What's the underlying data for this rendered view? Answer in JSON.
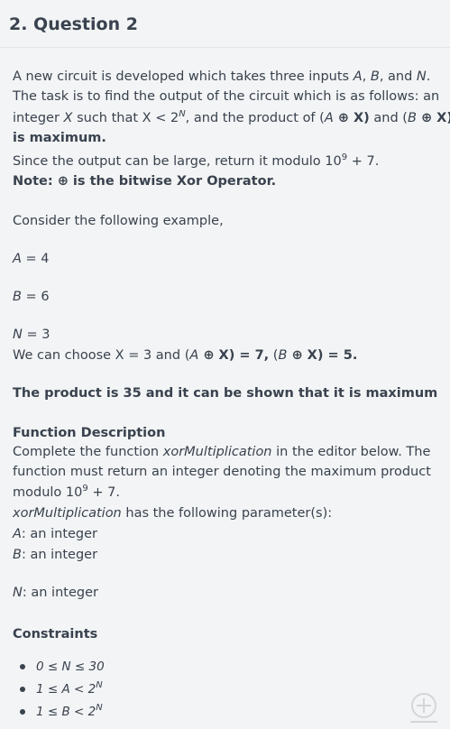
{
  "header": {
    "title": "2. Question 2"
  },
  "intro": {
    "l1_a": "A new circuit is developed which takes three inputs ",
    "l1_A": "A",
    "l1_comma": ", ",
    "l1_B": "B",
    "l1_and": ", and ",
    "l1_N": "N",
    "l1_end": ".",
    "l2": "The task is to find the output of the circuit which is as follows: an",
    "l3_a": "integer ",
    "l3_X": "X",
    "l3_b": " such that X < 2",
    "l3_N": "N",
    "l3_c": ", and the product of (",
    "l3_A": "A",
    "l3_xor1": " ⊕ ",
    "l3_d": "X)",
    "l3_e": " and (",
    "l3_B": "B",
    "l3_xor2": " ⊕ ",
    "l3_f": "X)",
    "l4": "is maximum.",
    "l5_a": "Since the output can be large, return it modulo 10",
    "l5_exp": "9",
    "l5_b": " + 7.",
    "l6_a": "Note: ",
    "l6_sym": "⊕",
    "l6_b": " is the bitwise Xor Operator."
  },
  "example": {
    "intro": "Consider the following example,",
    "a_var": "A",
    "a_val": " = 4",
    "b_var": "B",
    "b_val": " = 6",
    "n_var": "N",
    "n_val": " = 3",
    "choose_a": "We can choose X = 3 and (",
    "choose_A": "A",
    "choose_xor1": " ⊕ ",
    "choose_b": "X) = 7,",
    "choose_c": "  (",
    "choose_B": "B",
    "choose_xor2": " ⊕ ",
    "choose_d": "X) = 5.",
    "product": "The product is 35 and it can be shown that it is maximum"
  },
  "function_description": {
    "heading": "Function Description",
    "l1_a": "Complete the function ",
    "l1_fn": "xorMultiplication",
    "l1_b": " in the editor below. The",
    "l2": "function must return an integer denoting the maximum product",
    "l3_a": "modulo 10",
    "l3_exp": "9",
    "l3_b": " + 7.",
    "l4_fn": "xorMultiplication",
    "l4_b": " has the following parameter(s):",
    "p_a_var": "A",
    "p_a_desc": ": an integer",
    "p_b_var": "B",
    "p_b_desc": ": an integer",
    "p_n_var": "N",
    "p_n_desc": ": an integer"
  },
  "constraints": {
    "heading": "Constraints",
    "items": [
      {
        "text": "0 ≤ N ≤ 30",
        "exp": ""
      },
      {
        "text": "1 ≤ A < 2",
        "exp": "N"
      },
      {
        "text": "1 ≤ B < 2",
        "exp": "N"
      }
    ]
  }
}
